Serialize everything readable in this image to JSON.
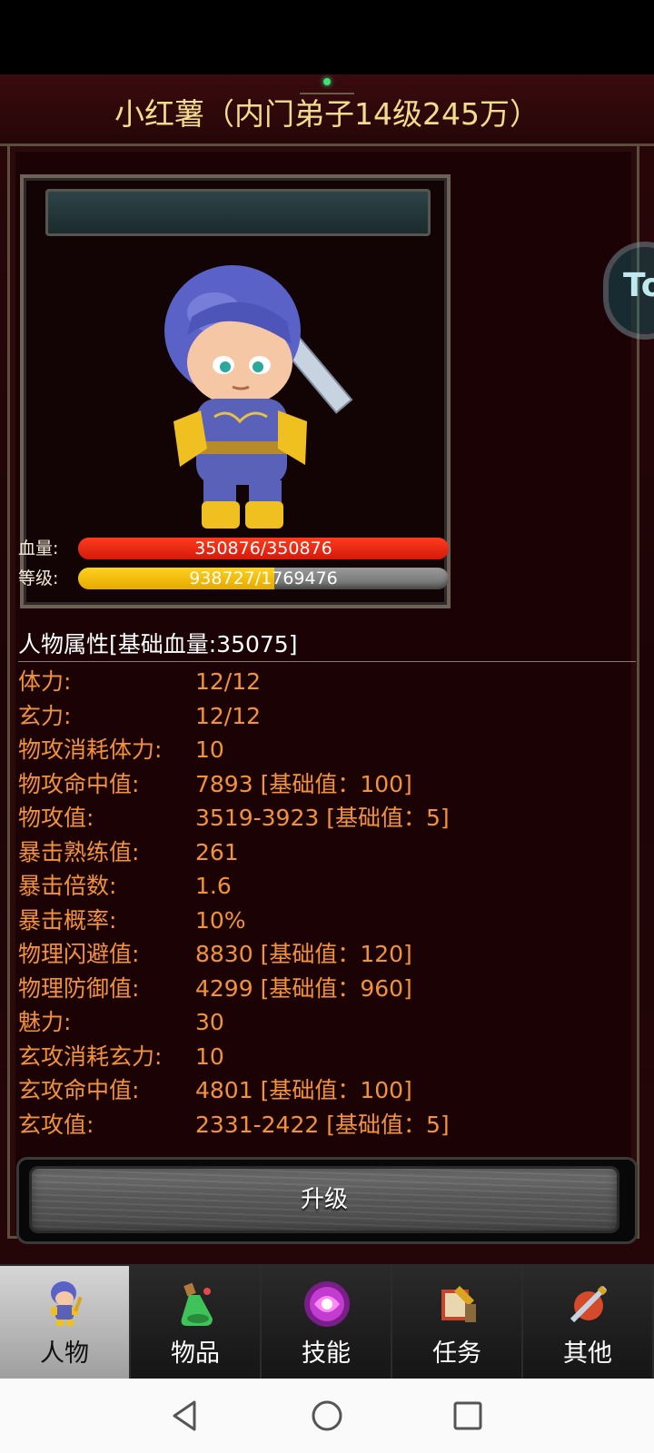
{
  "header": {
    "title": "小红薯（内门弟子14级245万）"
  },
  "character": {
    "hp": {
      "label": "血量:",
      "current": 350876,
      "max": 350876,
      "text": "350876/350876",
      "fill_fraction": 1.0
    },
    "level": {
      "label": "等级:",
      "current": 938727,
      "max": 1769476,
      "text": "938727/1769476",
      "fill_fraction": 0.53
    }
  },
  "attributes": {
    "header": "人物属性[基础血量:35075]",
    "rows": [
      {
        "name": "体力:",
        "value": "12/12"
      },
      {
        "name": "玄力:",
        "value": "12/12"
      },
      {
        "name": "物攻消耗体力:",
        "value": "10"
      },
      {
        "name": "物攻命中值:",
        "value": "7893 [基础值：100]"
      },
      {
        "name": "物攻值:",
        "value": "3519-3923 [基础值：5]"
      },
      {
        "name": "暴击熟练值:",
        "value": "261"
      },
      {
        "name": "暴击倍数:",
        "value": "1.6"
      },
      {
        "name": "暴击概率:",
        "value": "10%"
      },
      {
        "name": "物理闪避值:",
        "value": "8830 [基础值：120]"
      },
      {
        "name": "物理防御值:",
        "value": "4299 [基础值：960]"
      },
      {
        "name": "魅力:",
        "value": "30"
      },
      {
        "name": "玄攻消耗玄力:",
        "value": "10"
      },
      {
        "name": "玄攻命中值:",
        "value": "4801 [基础值：100]"
      },
      {
        "name": "玄攻值:",
        "value": "2331-2422 [基础值：5]"
      }
    ]
  },
  "upgrade_button": {
    "label": "升级"
  },
  "side_button": {
    "label": "To"
  },
  "tabs": [
    {
      "label": "人物",
      "icon": "character-icon",
      "active": true
    },
    {
      "label": "物品",
      "icon": "potion-icon",
      "active": false
    },
    {
      "label": "技能",
      "icon": "skill-orb-icon",
      "active": false
    },
    {
      "label": "任务",
      "icon": "quest-icon",
      "active": false
    },
    {
      "label": "其他",
      "icon": "other-icon",
      "active": false
    }
  ],
  "colors": {
    "title": "#f2dd8c",
    "attribute_text": "#f2923a",
    "hp_bar": "#e8220f",
    "level_bar": "#f5c400",
    "background": "#1b0305"
  }
}
